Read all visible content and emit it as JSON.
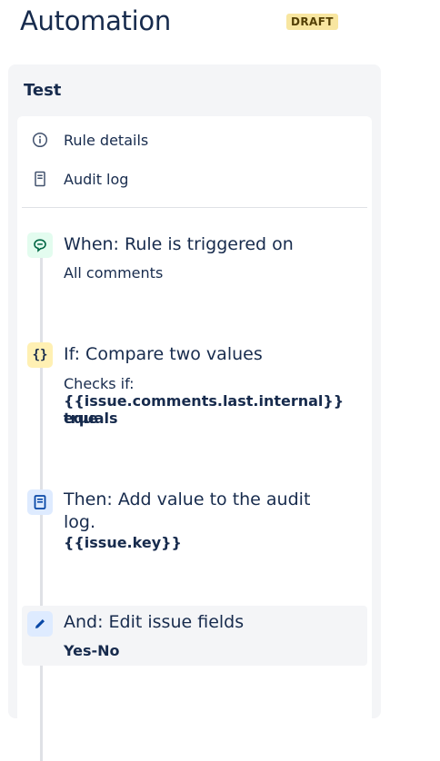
{
  "header": {
    "title": "Automation",
    "badge": "DRAFT"
  },
  "rule": {
    "name": "Test"
  },
  "menu": {
    "items": [
      {
        "label": "Rule details",
        "icon": "info-icon"
      },
      {
        "label": "Audit log",
        "icon": "audit-log-icon"
      }
    ]
  },
  "steps": [
    {
      "title": "When: Rule is triggered on",
      "detail": "All comments",
      "icon": "comment-trigger-icon",
      "icon_color": "#e3fcef"
    },
    {
      "title": "If: Compare two values",
      "detail_label": "Checks if:",
      "detail_line1": "{{issue.comments.last.internal}} equals",
      "detail_line2": "true",
      "icon": "condition-braces-icon",
      "icon_color": "#fff0b3"
    },
    {
      "title_line1": "Then: Add value to the audit",
      "title_line2": "log.",
      "detail": "{{issue.key}}",
      "icon": "audit-action-icon",
      "icon_color": "#deebff"
    },
    {
      "title": "And: Edit issue fields",
      "detail": "Yes-No",
      "icon": "pencil-icon",
      "icon_color": "#deebff",
      "selected": true
    }
  ]
}
